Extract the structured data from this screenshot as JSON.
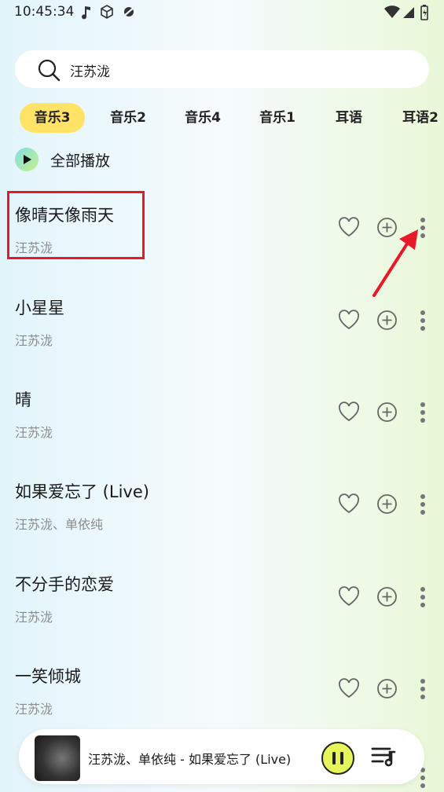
{
  "status_bar": {
    "time": "10:45:34"
  },
  "search": {
    "query": "汪苏泷"
  },
  "tabs": [
    {
      "label": "音乐3",
      "active": true
    },
    {
      "label": "音乐2",
      "active": false
    },
    {
      "label": "音乐4",
      "active": false
    },
    {
      "label": "音乐1",
      "active": false
    },
    {
      "label": "耳语",
      "active": false
    },
    {
      "label": "耳语2",
      "active": false
    }
  ],
  "play_all": {
    "label": "全部播放"
  },
  "songs": [
    {
      "title": "像晴天像雨天",
      "artist": "汪苏泷"
    },
    {
      "title": "小星星",
      "artist": "汪苏泷"
    },
    {
      "title": "晴",
      "artist": "汪苏泷"
    },
    {
      "title": "如果爱忘了 (Live)",
      "artist": "汪苏泷、单依纯"
    },
    {
      "title": "不分手的恋爱",
      "artist": "汪苏泷"
    },
    {
      "title": "一笑倾城",
      "artist": "汪苏泷"
    }
  ],
  "now_playing": {
    "text": "汪苏泷、单依纯 - 如果爱忘了 (Live)"
  },
  "colors": {
    "accent": "#ffe366",
    "highlight": "#e8182a",
    "pause_fill": "#e6f55a"
  },
  "icons": [
    "music-note-icon",
    "cube-icon",
    "no-mic-icon",
    "wifi-icon",
    "signal-icon",
    "battery-icon",
    "search-icon",
    "play-icon",
    "heart-icon",
    "add-circle-icon",
    "more-vert-icon",
    "pause-icon",
    "playlist-icon"
  ]
}
